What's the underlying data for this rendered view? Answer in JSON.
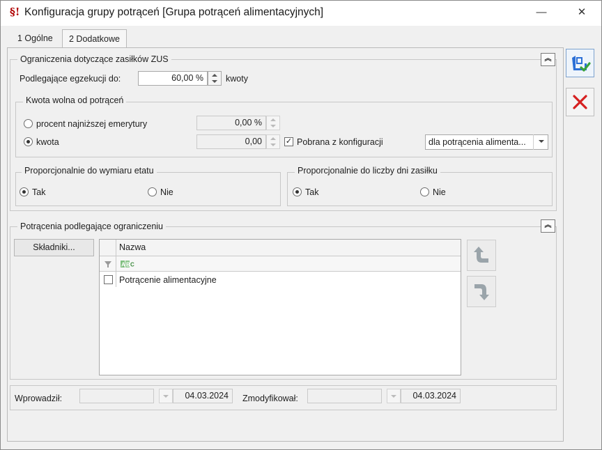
{
  "window": {
    "title": "Konfiguracja grupy potrąceń [Grupa potrąceń alimentacyjnych]",
    "minimize_glyph": "—",
    "close_glyph": "✕",
    "app_icon": "document-paragraph-icon"
  },
  "tabs": [
    {
      "label": "1 Ogólne",
      "active": false
    },
    {
      "label": "2 Dodatkowe",
      "active": true
    }
  ],
  "zus": {
    "group_label": "Ograniczenia dotyczące zasiłków ZUS",
    "egzekucja_label": "Podlegające egzekucji do:",
    "egzekucja_value": "60,00 %",
    "egzekucja_suffix": "kwoty",
    "kwota_wolna": {
      "group_label": "Kwota wolna od potrąceń",
      "option_procent": "procent najniższej emerytury",
      "procent_value": "0,00 %",
      "option_kwota": "kwota",
      "kwota_value": "0,00",
      "selected": "kwota",
      "pobrana_label": "Pobrana z konfiguracji",
      "pobrana_checked": true,
      "combo_value": "dla potrącenia alimenta..."
    },
    "etat": {
      "group_label": "Proporcjonalnie do wymiaru etatu",
      "option_tak": "Tak",
      "option_nie": "Nie",
      "selected": "Tak"
    },
    "dni": {
      "group_label": "Proporcjonalnie do liczby dni zasiłku",
      "option_tak": "Tak",
      "option_nie": "Nie",
      "selected": "Tak"
    }
  },
  "potracenia": {
    "group_label": "Potrącenia podlegające ograniczeniu",
    "skladniki_button": "Składniki...",
    "column_header": "Nazwa",
    "filter_icon": "funnel-icon",
    "filter_type_icon": "abc-text-icon",
    "rows": [
      {
        "name": "Potrącenie alimentacyjne",
        "checked": false
      }
    ]
  },
  "footer": {
    "wprowadzil_label": "Wprowadził:",
    "wprowadzil_user": "",
    "wprowadzil_date": "04.03.2024",
    "zmodyfikowal_label": "Zmodyfikował:",
    "zmodyfikowal_user": "",
    "zmodyfikowal_date": "04.03.2024"
  },
  "actions": {
    "save_icon": "save-disk-check-icon",
    "cancel_icon": "cancel-x-icon"
  },
  "colors": {
    "save_blue": "#2b6fd6",
    "save_green": "#3aa33a",
    "cancel_red": "#d62020"
  }
}
